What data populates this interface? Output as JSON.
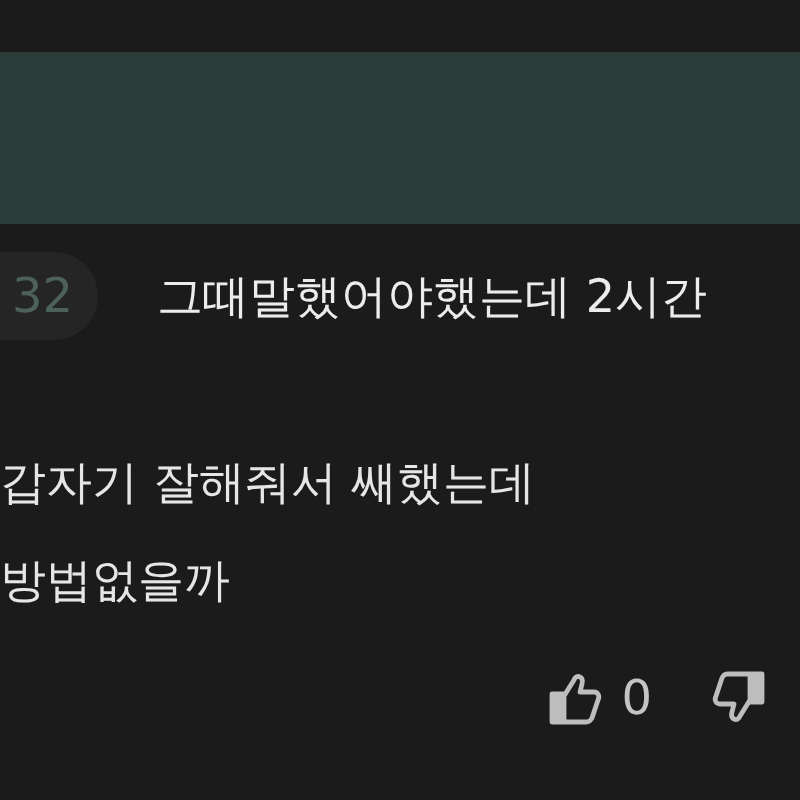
{
  "banner": {
    "kind": "bar"
  },
  "chapter": {
    "badge": "32",
    "title": "그때말했어야했는데 2시간"
  },
  "lines": [
    "갑자기 잘해줘서 쌔했는데",
    "방법없을까"
  ],
  "reactions": {
    "likes": "0"
  }
}
